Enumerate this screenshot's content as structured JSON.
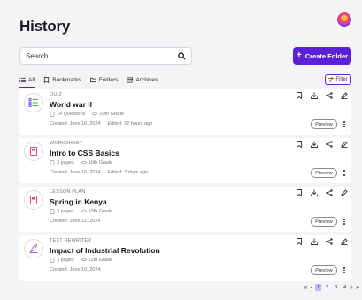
{
  "page": {
    "title": "History"
  },
  "search": {
    "placeholder": "Search"
  },
  "create_button": {
    "label": "Create Folder"
  },
  "tabs": [
    {
      "label": "All",
      "icon": "list-icon",
      "active": true
    },
    {
      "label": "Bookmarks",
      "icon": "bookmark-icon",
      "active": false
    },
    {
      "label": "Folders",
      "icon": "folder-icon",
      "active": false
    },
    {
      "label": "Archives",
      "icon": "archive-icon",
      "active": false
    }
  ],
  "filter": {
    "label": "Filter"
  },
  "items": [
    {
      "type": "QUIZ",
      "title": "World war II",
      "count": "14 Questions",
      "grade": "10th Grade",
      "created": "Created: June 16, 2024",
      "edited": "Edited: 22 hours ago",
      "icon": "quiz-icon"
    },
    {
      "type": "WORKSHEET",
      "title": "Intro to CSS Basics",
      "count": "3 pages",
      "grade": "10th Grade",
      "created": "Created: June 16, 2024",
      "edited": "Edited: 2 days ago",
      "icon": "worksheet-icon"
    },
    {
      "type": "LESSON PLAN",
      "title": "Spring in Kenya",
      "count": "3 pages",
      "grade": "10th Grade",
      "created": "Created: June 12, 2024",
      "edited": "",
      "icon": "lesson-plan-icon"
    },
    {
      "type": "TEXT REWRITER",
      "title": "Impact of Industrial Revolution",
      "count": "3 pages",
      "grade": "12th Grade",
      "created": "Created: June 10, 2024",
      "edited": "",
      "icon": "rewriter-icon"
    }
  ],
  "card_actions": {
    "preview_label": "Preview"
  },
  "pagination": {
    "pages": [
      "1",
      "2",
      "3",
      "4"
    ],
    "current": "1"
  },
  "colors": {
    "accent": "#5b21d8",
    "background": "#f4f4f6",
    "icon_pink": "#e0457b"
  }
}
